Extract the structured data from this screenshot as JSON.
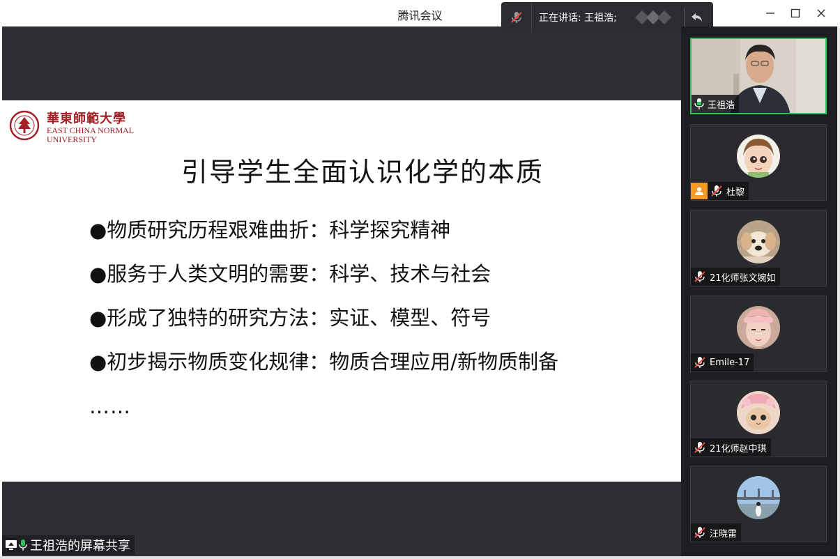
{
  "window": {
    "title": "腾讯会议",
    "controls": [
      "minimize",
      "maximize",
      "close"
    ]
  },
  "speaking": {
    "label": "正在讲话: 王祖浩;"
  },
  "slide": {
    "logo": {
      "cn": "華東師範大學",
      "en_line1": "EAST CHINA NORMAL",
      "en_line2": "UNIVERSITY"
    },
    "title": "引导学生全面认识化学的本质",
    "bullets": [
      "●物质研究历程艰难曲折：科学探究精神",
      "●服务于人类文明的需要：科学、技术与社会",
      "●形成了独特的研究方法：实证、模型、符号",
      "●初步揭示物质变化规律：物质合理应用/新物质制备"
    ],
    "ellipsis": "……"
  },
  "share_label": "王祖浩的屏幕共享",
  "participants": [
    {
      "name": "王祖浩",
      "mic": "on",
      "active": true
    },
    {
      "name": "杜黎",
      "mic": "muted",
      "has_user_icon": true
    },
    {
      "name": "21化师张文婉如",
      "mic": "muted"
    },
    {
      "name": "Emile-17",
      "mic": "muted"
    },
    {
      "name": "21化师赵中琪",
      "mic": "muted"
    },
    {
      "name": "汪晓雷",
      "mic": "muted"
    }
  ],
  "colors": {
    "brand_red": "#a31f24",
    "active_border": "#2fc25b",
    "mic_on": "#2fc25b",
    "mic_muted": "#e84c3d"
  }
}
